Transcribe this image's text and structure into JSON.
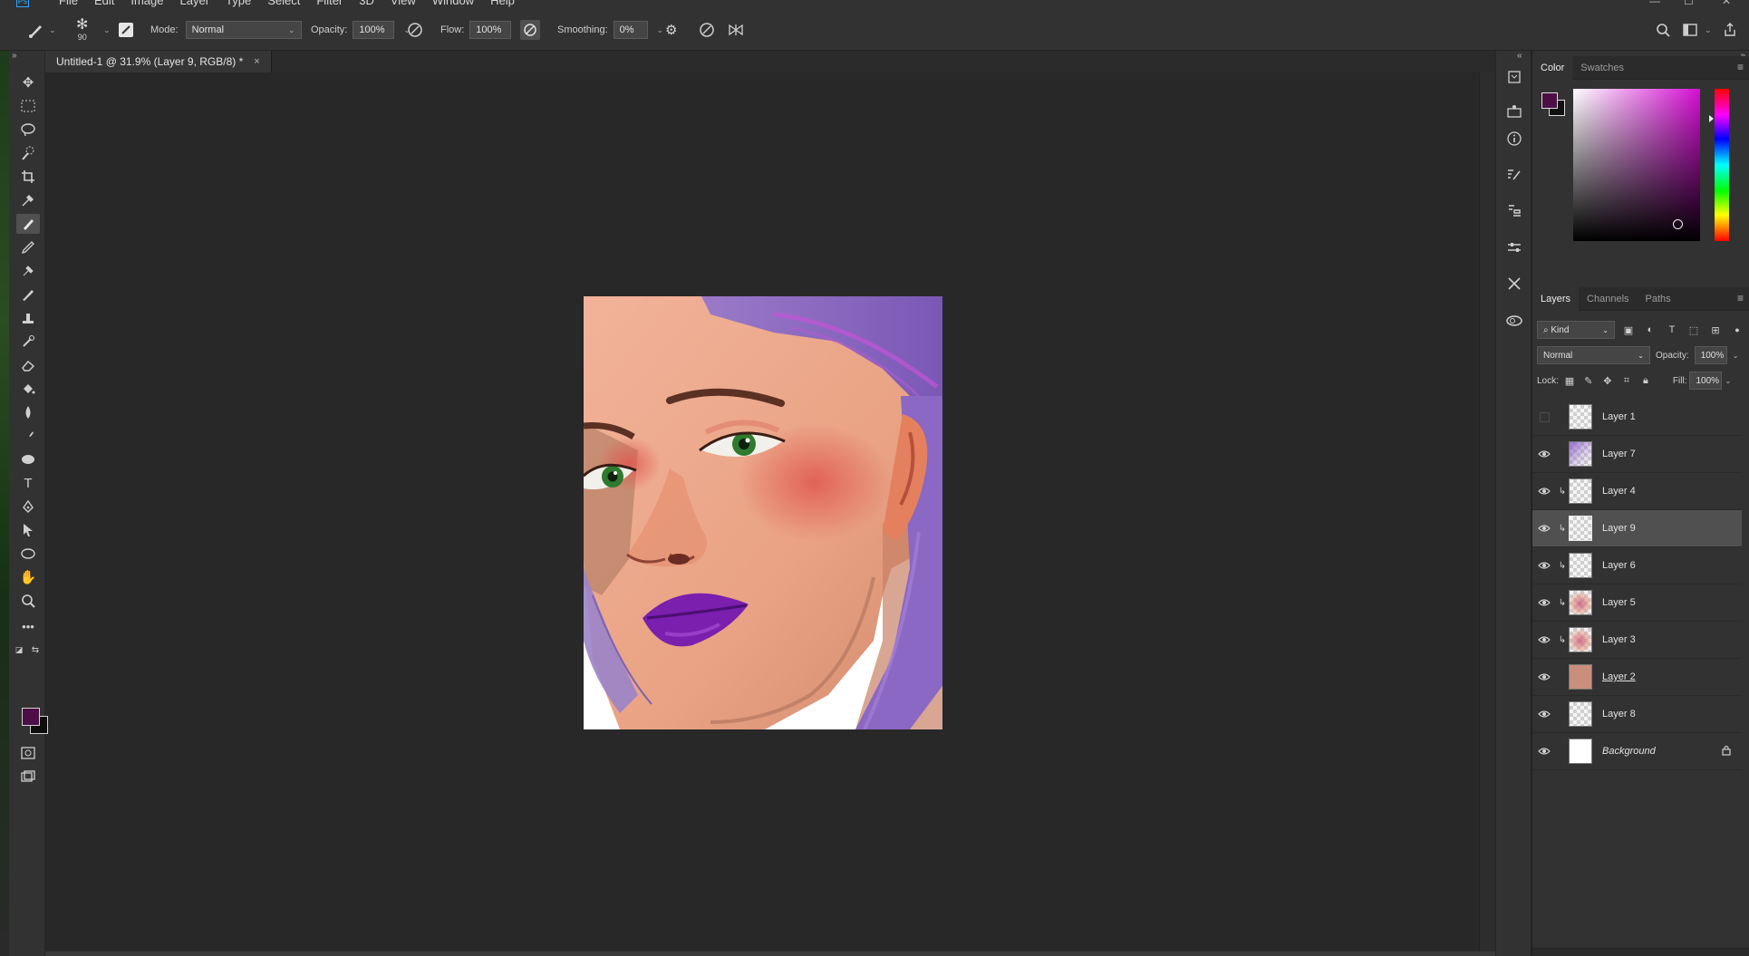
{
  "menubar": {
    "logo": "Ps",
    "items": [
      "File",
      "Edit",
      "Image",
      "Layer",
      "Type",
      "Select",
      "Filter",
      "3D",
      "View",
      "Window",
      "Help"
    ]
  },
  "options": {
    "brush_size": "90",
    "mode_label": "Mode:",
    "mode_value": "Normal",
    "opacity_label": "Opacity:",
    "opacity_value": "100%",
    "flow_label": "Flow:",
    "flow_value": "100%",
    "smoothing_label": "Smoothing:",
    "smoothing_value": "0%"
  },
  "document": {
    "tab_title": "Untitled-1 @ 31.9% (Layer 9, RGB/8) *",
    "close": "×"
  },
  "color_panel": {
    "tabs": [
      "Color",
      "Swatches"
    ],
    "foreground": "#4b0f46",
    "background": "#111111",
    "hue": "#d40fd3"
  },
  "layers_panel": {
    "tabs": [
      "Layers",
      "Channels",
      "Paths"
    ],
    "filter_kind": "Kind",
    "blend_mode": "Normal",
    "opacity_label": "Opacity:",
    "opacity_value": "100%",
    "lock_label": "Lock:",
    "fill_label": "Fill:",
    "fill_value": "100%",
    "layers": [
      {
        "name": "Layer 1",
        "visible": false,
        "clipped": false,
        "thumb": "transparent",
        "selected": false
      },
      {
        "name": "Layer 7",
        "visible": true,
        "clipped": false,
        "thumb": "purple",
        "selected": false
      },
      {
        "name": "Layer 4",
        "visible": true,
        "clipped": true,
        "thumb": "transparent",
        "selected": false
      },
      {
        "name": "Layer 9",
        "visible": true,
        "clipped": true,
        "thumb": "transparent",
        "selected": true
      },
      {
        "name": "Layer 6",
        "visible": true,
        "clipped": true,
        "thumb": "transparent",
        "selected": false
      },
      {
        "name": "Layer 5",
        "visible": true,
        "clipped": true,
        "thumb": "face",
        "selected": false
      },
      {
        "name": "Layer 3",
        "visible": true,
        "clipped": true,
        "thumb": "face",
        "selected": false
      },
      {
        "name": "Layer 2",
        "visible": true,
        "clipped": false,
        "thumb": "skin",
        "selected": false
      },
      {
        "name": "Layer 8",
        "visible": true,
        "clipped": false,
        "thumb": "transparent",
        "selected": false
      },
      {
        "name": "Background",
        "visible": true,
        "clipped": false,
        "thumb": "white",
        "selected": false,
        "locked": true
      }
    ]
  }
}
